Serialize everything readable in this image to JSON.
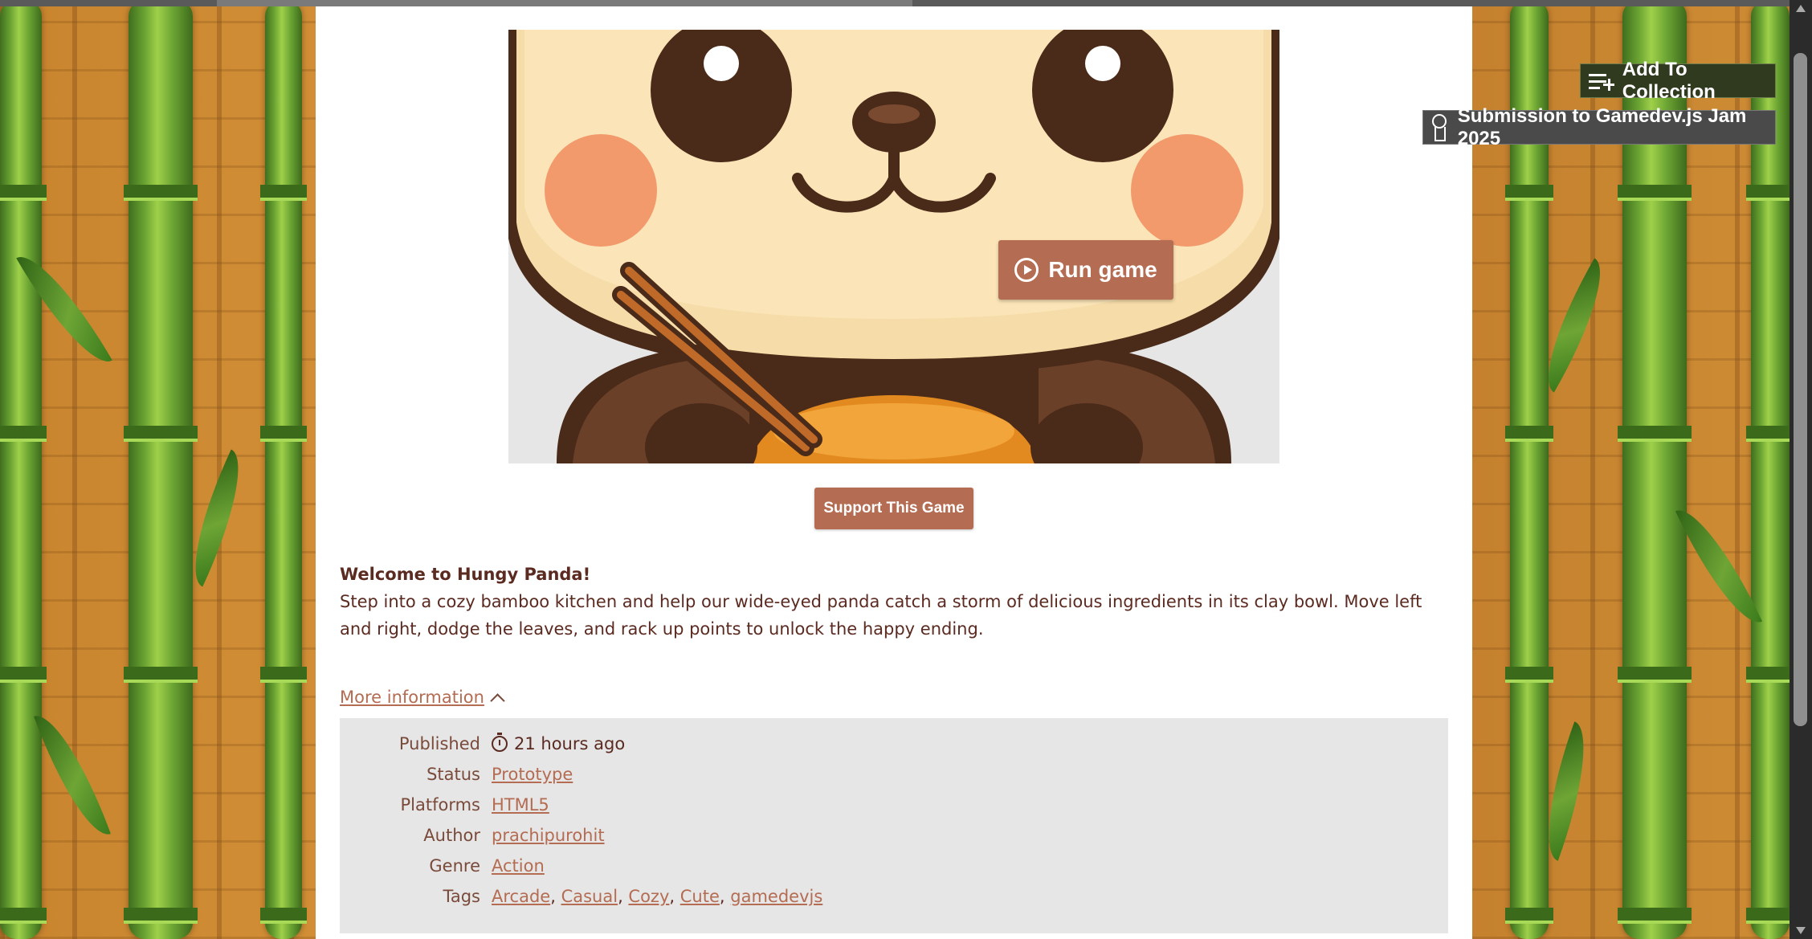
{
  "game": {
    "run_label": "Run game",
    "support_label": "Support This Game"
  },
  "floating": {
    "collection_label": "Add To Collection",
    "jam_label": "Submission to Gamedev.js Jam 2025"
  },
  "description": {
    "welcome": "Welcome to Hungy Panda!",
    "body": "Step into a cozy bamboo kitchen and help our wide-eyed panda catch a storm of delicious ingredients in its clay bowl. Move left and right, dodge the leaves, and rack up points to unlock the happy ending."
  },
  "more_info": {
    "label": "More information"
  },
  "info": {
    "published_key": "Published",
    "published_val": "21 hours ago",
    "status_key": "Status",
    "status_val": "Prototype",
    "platforms_key": "Platforms",
    "platforms_val": "HTML5",
    "author_key": "Author",
    "author_val": "prachipurohit",
    "genre_key": "Genre",
    "genre_val": "Action",
    "tags_key": "Tags",
    "tags": [
      "Arcade",
      "Casual",
      "Cozy",
      "Cute",
      "gamedevjs"
    ]
  },
  "colors": {
    "accent": "#b46c52",
    "text": "#5b2a20",
    "panel": "#e6e6e6"
  }
}
